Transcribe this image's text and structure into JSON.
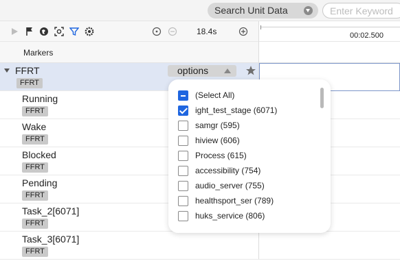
{
  "search": {
    "selected": "Search Unit Data",
    "placeholder": "Enter Keyword"
  },
  "toolbar": {
    "icons": [
      "play-icon",
      "flag-icon",
      "globe-icon",
      "capture-icon",
      "filter-icon",
      "settings-icon"
    ],
    "duration": "18.4s"
  },
  "ruler": {
    "timestamp": "00:02.500"
  },
  "markers": {
    "label": "Markers"
  },
  "process": {
    "name": "FFRT",
    "tag": "FFRT",
    "options_label": "options"
  },
  "threads": [
    {
      "name": "Running",
      "tag": "FFRT"
    },
    {
      "name": "Wake",
      "tag": "FFRT"
    },
    {
      "name": "Blocked",
      "tag": "FFRT"
    },
    {
      "name": "Pending",
      "tag": "FFRT"
    },
    {
      "name": "Task_2[6071]",
      "tag": "FFRT"
    },
    {
      "name": "Task_3[6071]",
      "tag": "FFRT"
    }
  ],
  "dropdown": {
    "items": [
      {
        "label": "(Select All)",
        "state": "indeterminate"
      },
      {
        "label": "ight_test_stage (6071)",
        "state": "checked"
      },
      {
        "label": "samgr (595)",
        "state": "unchecked"
      },
      {
        "label": "hiview (606)",
        "state": "unchecked"
      },
      {
        "label": "Process (615)",
        "state": "unchecked"
      },
      {
        "label": "accessibility (754)",
        "state": "unchecked"
      },
      {
        "label": "audio_server (755)",
        "state": "unchecked"
      },
      {
        "label": "healthsport_ser (789)",
        "state": "unchecked"
      },
      {
        "label": "huks_service (806)",
        "state": "unchecked"
      }
    ]
  },
  "colors": {
    "accent": "#1f66e0",
    "selected_row": "#dfe6f4"
  }
}
